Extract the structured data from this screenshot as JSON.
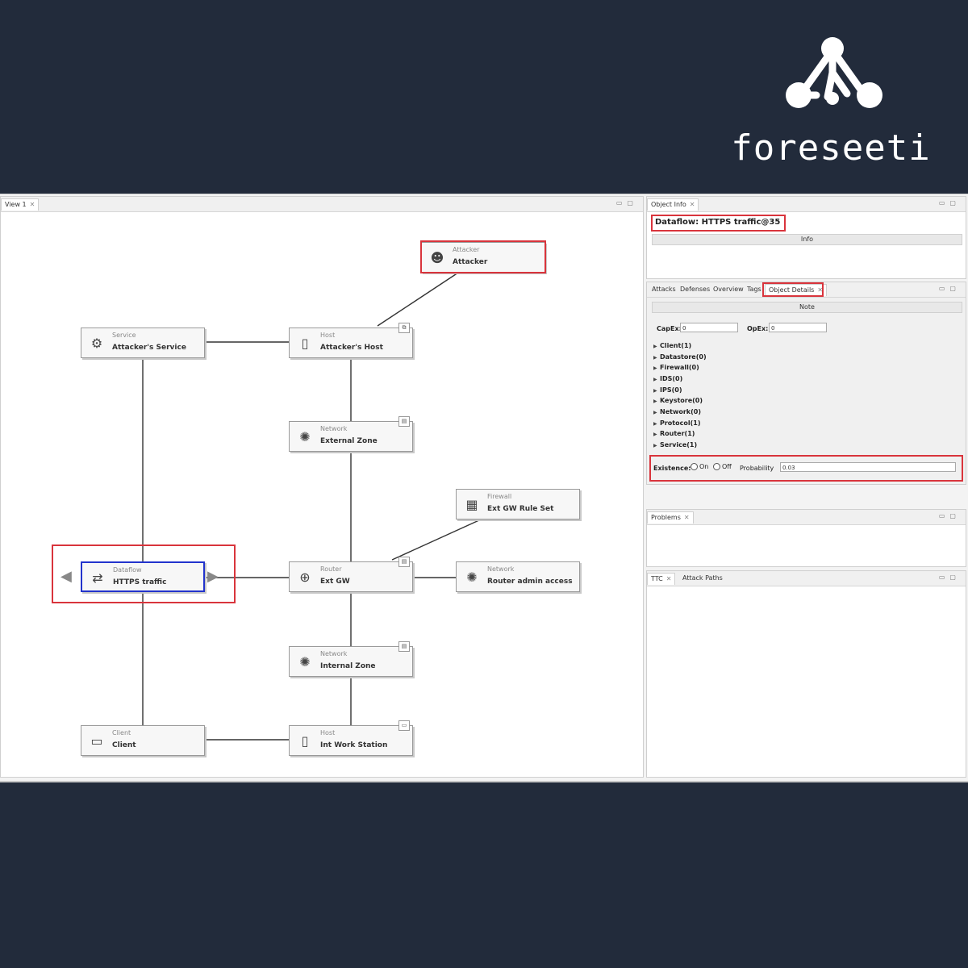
{
  "brand": {
    "name": "foreseeti"
  },
  "left_pane": {
    "tab": "View 1",
    "nodes": {
      "attacker": {
        "type": "Attacker",
        "name": "Attacker"
      },
      "attackers_service": {
        "type": "Service",
        "name": "Attacker's Service"
      },
      "attackers_host": {
        "type": "Host",
        "name": "Attacker's Host"
      },
      "external_zone": {
        "type": "Network",
        "name": "External Zone"
      },
      "firewall": {
        "type": "Firewall",
        "name": "Ext GW Rule Set"
      },
      "dataflow": {
        "type": "Dataflow",
        "name": "HTTPS traffic"
      },
      "router": {
        "type": "Router",
        "name": "Ext GW"
      },
      "router_admin": {
        "type": "Network",
        "name": "Router admin access"
      },
      "internal_zone": {
        "type": "Network",
        "name": "Internal Zone"
      },
      "client": {
        "type": "Client",
        "name": "Client"
      },
      "int_work_station": {
        "type": "Host",
        "name": "Int Work Station"
      }
    }
  },
  "object_info": {
    "tab": "Object Info",
    "title": "Dataflow: HTTPS traffic@35",
    "info_bar": "Info"
  },
  "details": {
    "tabs": [
      "Attacks",
      "Defenses",
      "Overview",
      "Tags",
      "Object Details"
    ],
    "note_bar": "Note",
    "capex_label": "CapEx:",
    "capex_value": "0",
    "opex_label": "OpEx:",
    "opex_value": "0",
    "tree": [
      "Client(1)",
      "Datastore(0)",
      "Firewall(0)",
      "IDS(0)",
      "IPS(0)",
      "Keystore(0)",
      "Network(0)",
      "Protocol(1)",
      "Router(1)",
      "Service(1)"
    ],
    "existence_label": "Existence:",
    "on_label": "On",
    "off_label": "Off",
    "probability_label": "Probability",
    "probability_value": "0.03"
  },
  "problems": {
    "tab": "Problems"
  },
  "bottom": {
    "tabs": [
      "TTC",
      "Attack Paths"
    ]
  },
  "colors": {
    "background": "#222b3b",
    "highlight": "#d9343c",
    "selection": "#2233cc"
  }
}
